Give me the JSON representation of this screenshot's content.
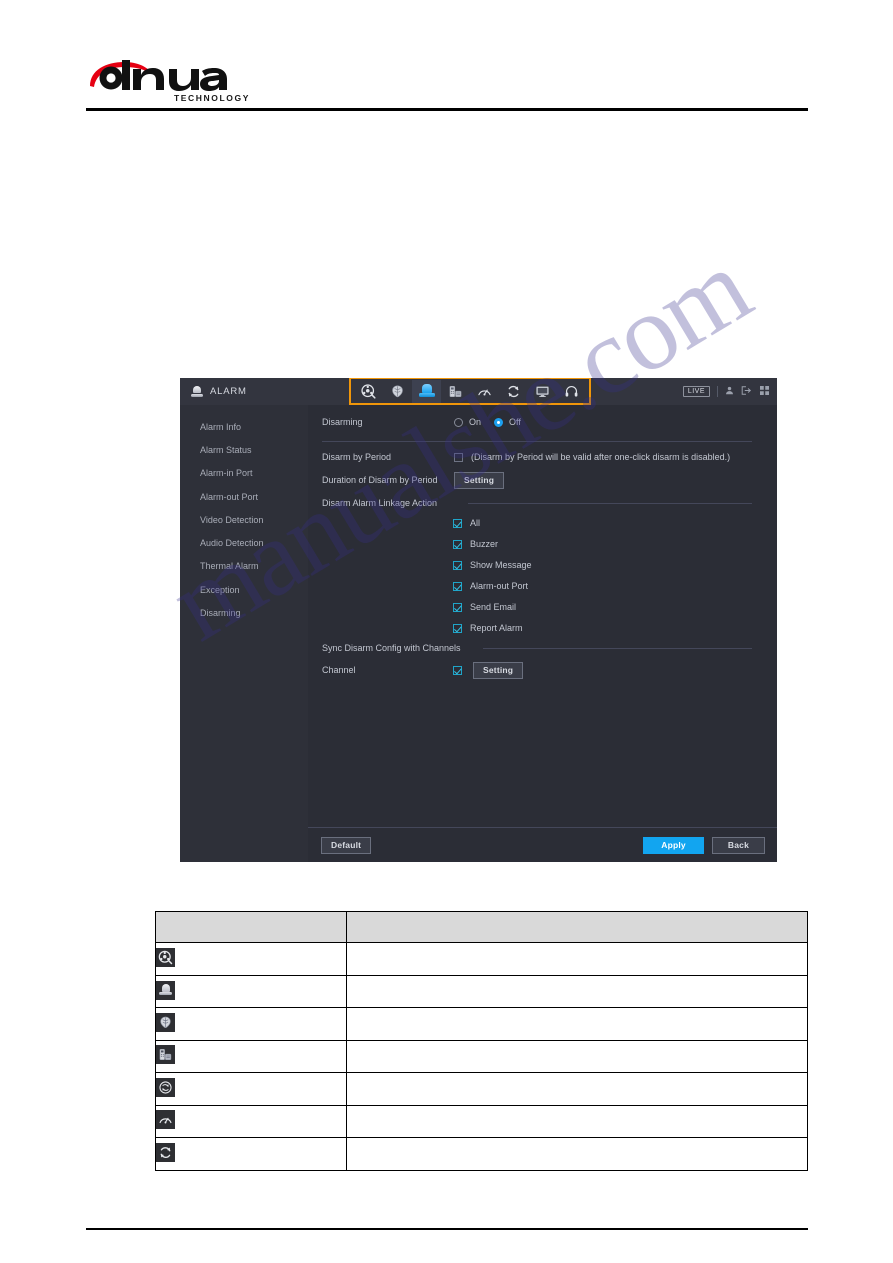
{
  "brand": {
    "name": "alhua",
    "tagline": "TECHNOLOGY"
  },
  "watermark": {
    "text": "manualshe.com"
  },
  "nvr": {
    "window_title": "ALARM",
    "title_icon": "alarm-siren-icon",
    "topnav": {
      "icons": [
        {
          "name": "ai-search-icon",
          "label": "AI Search",
          "active": false
        },
        {
          "name": "ai-brain-icon",
          "label": "AI",
          "active": false
        },
        {
          "name": "alarm-siren-icon",
          "label": "Alarm",
          "active": true
        },
        {
          "name": "pos-device-icon",
          "label": "POS",
          "active": false
        },
        {
          "name": "network-gauge-icon",
          "label": "Network",
          "active": false
        },
        {
          "name": "maintenance-refresh-icon",
          "label": "Maintenance",
          "active": false
        },
        {
          "name": "display-monitor-icon",
          "label": "Display",
          "active": false
        },
        {
          "name": "audio-headphone-icon",
          "label": "Audio",
          "active": false
        }
      ]
    },
    "status": {
      "live_label": "LIVE",
      "icons": [
        "user-icon",
        "logout-icon",
        "grid-icon"
      ]
    },
    "sidebar": {
      "items": [
        {
          "label": "Alarm Info"
        },
        {
          "label": "Alarm Status"
        },
        {
          "label": "Alarm-in Port"
        },
        {
          "label": "Alarm-out Port"
        },
        {
          "label": "Video Detection"
        },
        {
          "label": "Audio Detection"
        },
        {
          "label": "Thermal Alarm"
        },
        {
          "label": "Exception"
        },
        {
          "label": "Disarming"
        }
      ]
    },
    "form": {
      "disarming_label": "Disarming",
      "radio_on_label": "On",
      "radio_off_label": "Off",
      "radio_selected": "Off",
      "disarm_by_period_label": "Disarm by Period",
      "disarm_by_period_checked": false,
      "disarm_by_period_hint": "(Disarm by Period will be valid after one-click disarm is disabled.)",
      "duration_label": "Duration of Disarm by Period",
      "duration_button": "Setting",
      "linkage_section_label": "Disarm Alarm Linkage Action",
      "linkage_items": [
        {
          "label": "All",
          "checked": true
        },
        {
          "label": "Buzzer",
          "checked": true
        },
        {
          "label": "Show Message",
          "checked": true
        },
        {
          "label": "Alarm-out Port",
          "checked": true
        },
        {
          "label": "Send Email",
          "checked": true
        },
        {
          "label": "Report Alarm",
          "checked": true
        }
      ],
      "sync_section_label": "Sync Disarm Config with Channels",
      "channel_label": "Channel",
      "channel_checked": true,
      "channel_button": "Setting"
    },
    "footer": {
      "default_label": "Default",
      "apply_label": "Apply",
      "back_label": "Back",
      "apply_color": "#12a5f0"
    }
  },
  "legend_table": {
    "headers": [
      "",
      ""
    ],
    "rows": [
      {
        "icon": "ai-search-icon",
        "description": ""
      },
      {
        "icon": "alarm-siren-icon",
        "description": ""
      },
      {
        "icon": "ai-brain-icon",
        "description": ""
      },
      {
        "icon": "pos-device-icon",
        "description": ""
      },
      {
        "icon": "maintenance-refresh-icon",
        "description": ""
      },
      {
        "icon": "network-gauge-icon",
        "description": ""
      },
      {
        "icon": "sync-refresh-icon",
        "description": ""
      }
    ]
  }
}
